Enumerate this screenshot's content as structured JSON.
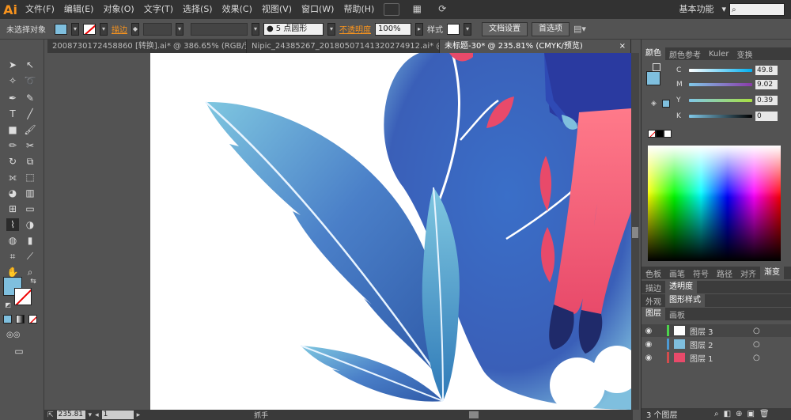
{
  "app": {
    "logo": "Ai"
  },
  "menu": [
    "文件(F)",
    "编辑(E)",
    "对象(O)",
    "文字(T)",
    "选择(S)",
    "效果(C)",
    "视图(V)",
    "窗口(W)",
    "帮助(H)"
  ],
  "workspace": {
    "label": "基本功能",
    "search_placeholder": ""
  },
  "options": {
    "selection_label": "未选择对象",
    "stroke_label": "描边",
    "brush_value": "5 点圆形",
    "opacity_label": "不透明度",
    "opacity_value": "100%",
    "style_label": "样式",
    "doc_setup": "文档设置",
    "preferences": "首选项"
  },
  "tabs": [
    {
      "label": "20087301724588​60 [转换].ai* @ 386.65% (RGB/预..."
    },
    {
      "label": "Nipic_24385267_20180507141320274912.ai* @ 43..."
    },
    {
      "label": "未标题-30* @ 235.81% (CMYK/预览)"
    }
  ],
  "status": {
    "zoom": "235.81",
    "page": "1",
    "tool": "抓手"
  },
  "panels": {
    "color_tabs": [
      "颜色",
      "颜色参考",
      "Kuler",
      "变换"
    ],
    "cmyk": [
      {
        "label": "C",
        "value": "49.8",
        "pct": 0.498
      },
      {
        "label": "M",
        "value": "9.02",
        "pct": 0.09
      },
      {
        "label": "Y",
        "value": "0.39",
        "pct": 0.004
      },
      {
        "label": "K",
        "value": "0",
        "pct": 0
      }
    ],
    "swatch_tabs": [
      "色板",
      "画笔",
      "符号",
      "路径",
      "对齐",
      "渐变"
    ],
    "stroke_tabs": [
      "描边",
      "透明度"
    ],
    "appearance_tabs": [
      "外观",
      "图形样式"
    ],
    "layer_tabs": [
      "图层",
      "画板"
    ],
    "layers": [
      {
        "name": "图层 3",
        "color": "#4cd44c"
      },
      {
        "name": "图层 2",
        "color": "#4c9ad4"
      },
      {
        "name": "图层 1",
        "color": "#d44c4c"
      }
    ],
    "layers_count": "3 个图层"
  },
  "colors": {
    "fill": "#7fbfde",
    "accent": "#f7931e"
  }
}
